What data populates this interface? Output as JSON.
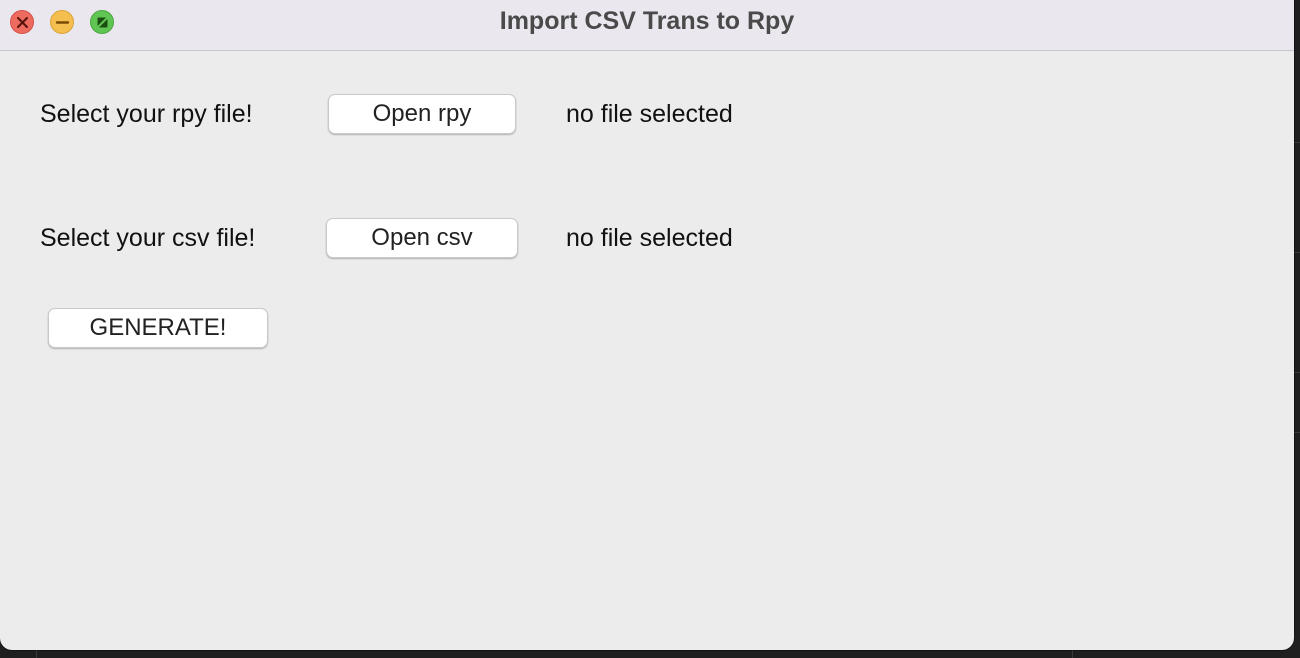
{
  "window": {
    "title": "Import CSV Trans to Rpy"
  },
  "traffic_lights": {
    "close": "close-icon",
    "minimize": "minimize-icon",
    "maximize": "fullscreen-icon"
  },
  "rpy": {
    "prompt": "Select your rpy file!",
    "button_label": "Open rpy",
    "status": "no file selected"
  },
  "csv": {
    "prompt": "Select your csv file!",
    "button_label": "Open csv",
    "status": "no file selected"
  },
  "generate": {
    "button_label": "GENERATE!"
  },
  "colors": {
    "window_bg": "#ececec",
    "titlebar_bg": "#ebe7ef",
    "close": "#ed6a5e",
    "minimize": "#f5bf4f",
    "maximize": "#61c554"
  }
}
